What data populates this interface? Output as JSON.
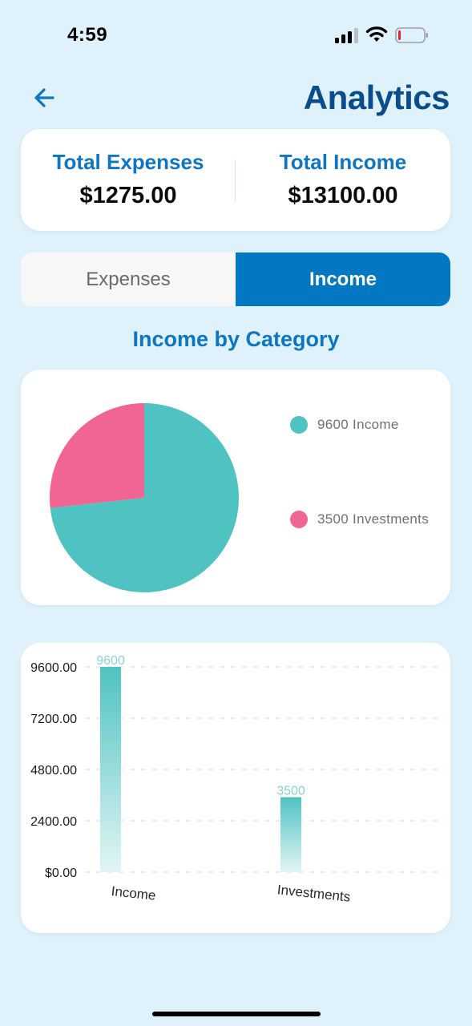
{
  "status_bar": {
    "time": "4:59",
    "icons": [
      "signal-icon",
      "wifi-icon",
      "battery-icon"
    ]
  },
  "header": {
    "back_icon": "arrow-left-icon",
    "title": "Analytics"
  },
  "totals": {
    "expenses_label": "Total Expenses",
    "expenses_value": "$1275.00",
    "income_label": "Total Income",
    "income_value": "$13100.00"
  },
  "toggle": {
    "options": [
      "Expenses",
      "Income"
    ],
    "selected": "Income"
  },
  "section_title": "Income by Category",
  "colors": {
    "background": "#dff1fb",
    "accent": "#0377c2",
    "title": "#0a4d8c",
    "teal": "#4fc3c1",
    "pink": "#f06592"
  },
  "pie_legend": [
    {
      "label": "9600 Income",
      "color": "#4fc3c1"
    },
    {
      "label": "3500 Investments",
      "color": "#f06592"
    }
  ],
  "chart_data": [
    {
      "type": "pie",
      "categories": [
        "Income",
        "Investments"
      ],
      "values": [
        9600,
        3500
      ],
      "colors": [
        "#4fc3c1",
        "#f06592"
      ],
      "legend_position": "right"
    },
    {
      "type": "bar",
      "categories": [
        "Income",
        "Investments"
      ],
      "values": [
        9600,
        3500
      ],
      "value_labels": [
        "9600",
        "3500"
      ],
      "y_ticks": [
        "$0.00",
        "2400.00",
        "4800.00",
        "7200.00",
        "9600.00"
      ],
      "ylim": [
        0,
        9600
      ],
      "grid": "dashed-horizontal"
    }
  ]
}
